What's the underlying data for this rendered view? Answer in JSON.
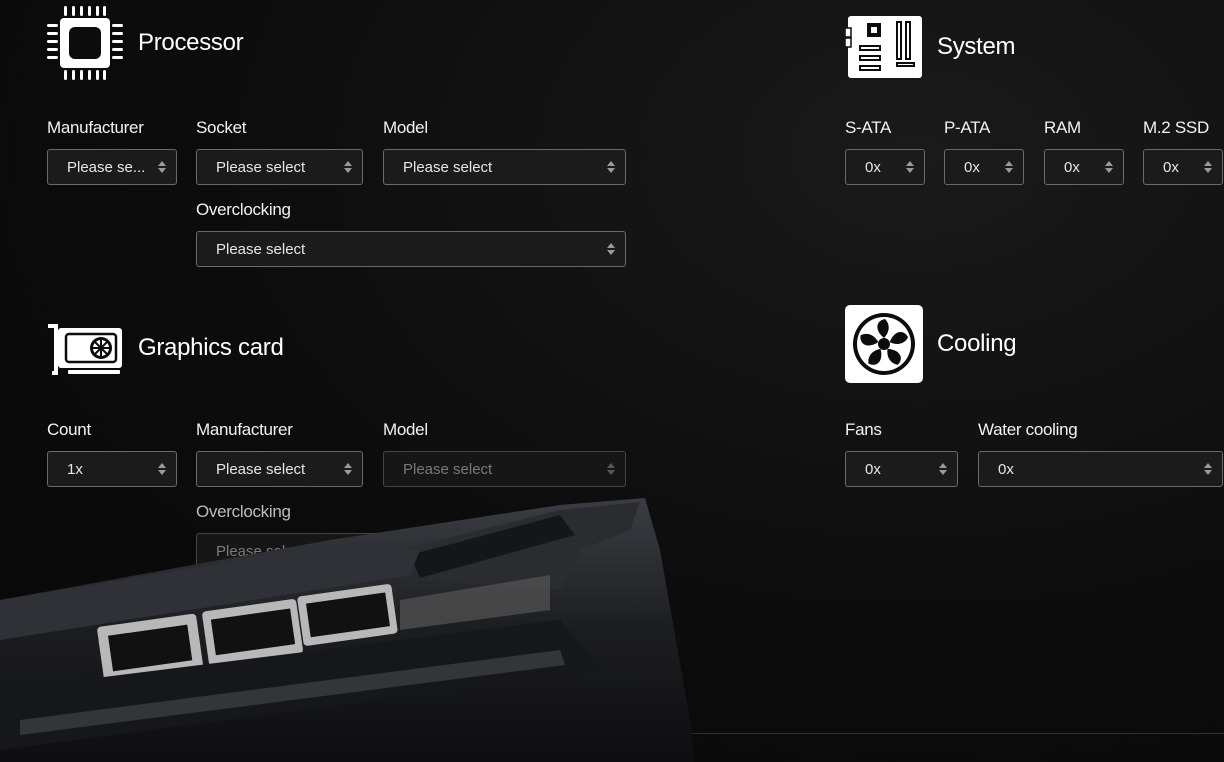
{
  "processor": {
    "title": "Processor",
    "icon": "cpu-icon",
    "fields": {
      "manufacturer": {
        "label": "Manufacturer",
        "value": "Please se..."
      },
      "socket": {
        "label": "Socket",
        "value": "Please select"
      },
      "model": {
        "label": "Model",
        "value": "Please select"
      },
      "overclocking": {
        "label": "Overclocking",
        "value": "Please select"
      }
    }
  },
  "system": {
    "title": "System",
    "icon": "motherboard-icon",
    "fields": {
      "sata": {
        "label": "S-ATA",
        "value": "0x"
      },
      "pata": {
        "label": "P-ATA",
        "value": "0x"
      },
      "ram": {
        "label": "RAM",
        "value": "0x"
      },
      "m2ssd": {
        "label": "M.2 SSD",
        "value": "0x"
      }
    }
  },
  "graphics": {
    "title": "Graphics card",
    "icon": "graphics-card-icon",
    "fields": {
      "count": {
        "label": "Count",
        "value": "1x"
      },
      "manufacturer": {
        "label": "Manufacturer",
        "value": "Please select"
      },
      "model": {
        "label": "Model",
        "value": "Please select",
        "disabled": true
      },
      "overclocking": {
        "label": "Overclocking",
        "value": "Please select",
        "disabled": true
      }
    }
  },
  "cooling": {
    "title": "Cooling",
    "icon": "fan-icon",
    "fields": {
      "fans": {
        "label": "Fans",
        "value": "0x"
      },
      "water": {
        "label": "Water cooling",
        "value": "0x"
      }
    }
  },
  "colors": {
    "background": "#0c0c0c",
    "select_bg": "#1b1b1b",
    "select_border": "#6a6a6a",
    "text": "#ffffff"
  }
}
